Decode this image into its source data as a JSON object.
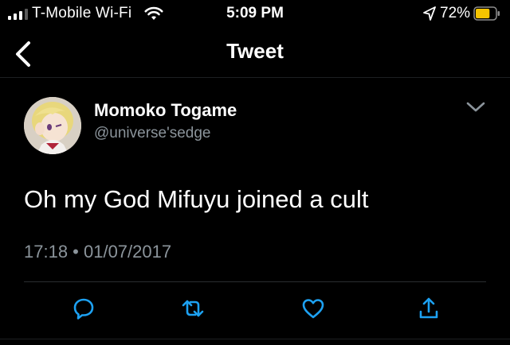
{
  "status_bar": {
    "carrier": "T-Mobile Wi-Fi",
    "time": "5:09 PM",
    "battery_percent": "72%",
    "battery_level": 0.72,
    "battery_color": "#f5c400"
  },
  "nav": {
    "title": "Tweet",
    "back_icon": "chevron-left-icon"
  },
  "tweet": {
    "display_name": "Momoko Togame",
    "handle": "@universe'sedge",
    "text": "Oh my God Mifuyu joined a cult",
    "timestamp": "17:18 • 01/07/2017",
    "menu_icon": "chevron-down-icon"
  },
  "actions": [
    {
      "name": "reply",
      "icon": "reply-icon"
    },
    {
      "name": "retweet",
      "icon": "retweet-icon"
    },
    {
      "name": "like",
      "icon": "heart-icon"
    },
    {
      "name": "share",
      "icon": "share-icon"
    }
  ],
  "colors": {
    "icon_blue": "#1da1f2",
    "secondary_text": "#8b949b"
  }
}
